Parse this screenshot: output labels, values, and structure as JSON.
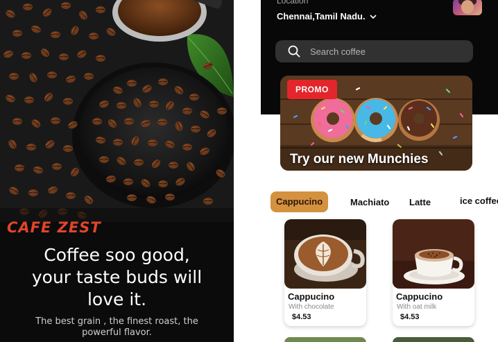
{
  "splash": {
    "brand": "CAFE ZEST",
    "headline_lines": [
      "Coffee soo good,",
      "your taste buds will",
      "love it."
    ],
    "subline_lines": [
      "The best grain , the finest roast, the",
      "powerful flavor."
    ]
  },
  "home": {
    "location_label": "Location",
    "location_value": "Chennai,Tamil Nadu.",
    "search_placeholder": "Search coffee",
    "promo_badge": "PROMO",
    "promo_text": "Try our new Munchies",
    "categories": [
      "Cappucino",
      "Machiato",
      "Latte",
      "ice coffee"
    ],
    "active_category": "Cappucino",
    "products": [
      {
        "name": "Cappucino",
        "desc": "With chocolate",
        "price": "$4.53"
      },
      {
        "name": "Cappucino",
        "desc": "With oat milk",
        "price": "$4.53"
      }
    ]
  },
  "icons": {
    "search": "search-icon",
    "chevron": "chevron-down-icon",
    "avatar": "avatar"
  },
  "colors": {
    "brand_red": "#e0452a",
    "accent": "#d4913f",
    "promo_red": "#e3262b",
    "dark_bg": "#080808"
  }
}
